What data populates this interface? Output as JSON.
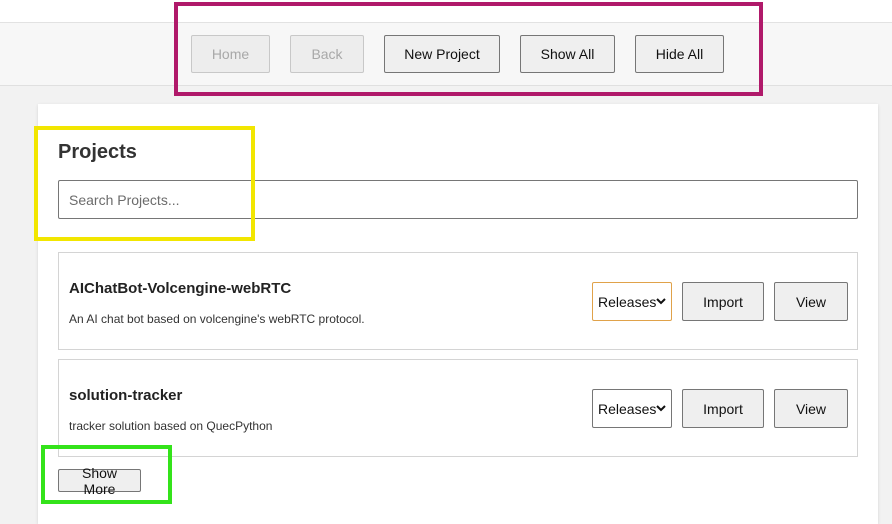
{
  "toolbar": {
    "home_label": "Home",
    "back_label": "Back",
    "new_project_label": "New Project",
    "show_all_label": "Show All",
    "hide_all_label": "Hide All"
  },
  "projects": {
    "title": "Projects",
    "search_placeholder": "Search Projects...",
    "items": [
      {
        "name": "AIChatBot-Volcengine-webRTC",
        "description": "An AI chat bot based on volcengine's webRTC protocol.",
        "select_value": "Releases",
        "import_label": "Import",
        "view_label": "View"
      },
      {
        "name": "solution-tracker",
        "description": "tracker solution based on QuecPython",
        "select_value": "Releases",
        "import_label": "Import",
        "view_label": "View"
      }
    ],
    "show_more_label": "Show More"
  },
  "colors": {
    "highlight_toolbar": "#b0196a",
    "highlight_title_search": "#f2e600",
    "highlight_show_more": "#34e31a",
    "select_focus": "#e0a24a"
  }
}
